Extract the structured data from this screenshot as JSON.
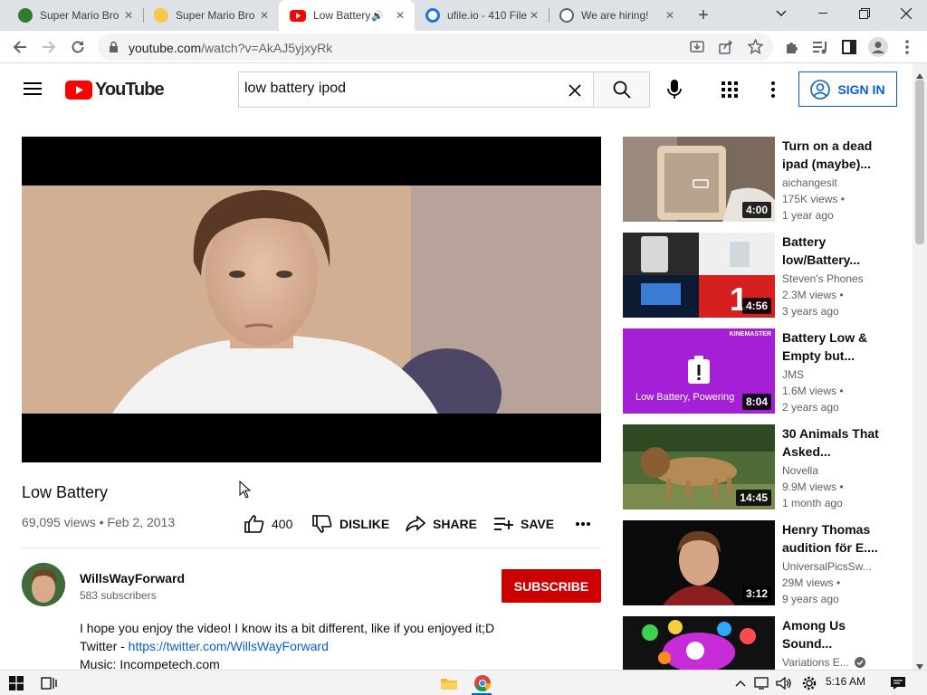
{
  "browser": {
    "tabs": [
      {
        "title": "Super Mario Bro",
        "favicon": "mario-favicon",
        "color": "#2e7d32",
        "active": false
      },
      {
        "title": "Super Mario Bro",
        "favicon": "banana-favicon",
        "color": "#f9c74f",
        "active": false
      },
      {
        "title": "Low Battery",
        "favicon": "youtube-favicon",
        "color": "#ff0000",
        "active": true
      },
      {
        "title": "ufile.io - 410 File",
        "favicon": "ufile-favicon",
        "color": "#1a73e8",
        "active": false
      },
      {
        "title": "We are hiring!",
        "favicon": "globe-favicon",
        "color": "#5f6368",
        "active": false
      }
    ],
    "new_tab": "+",
    "url_host": "youtube.com",
    "url_path": "/watch?v=AkAJ5yjxyRk"
  },
  "youtube": {
    "logo_text": "YouTube",
    "search_value": "low battery ipod",
    "search_placeholder": "Search",
    "sign_in": "SIGN IN"
  },
  "video": {
    "title": "Low Battery",
    "views": "69,095 views",
    "date": "Feb 2, 2013",
    "likes": "400",
    "dislike_label": "DISLIKE",
    "share_label": "SHARE",
    "save_label": "SAVE"
  },
  "channel": {
    "name": "WillsWayForward",
    "subscribers": "583 subscribers",
    "subscribe_label": "SUBSCRIBE"
  },
  "description": {
    "line1": "I hope you enjoy the video! I know its a bit different, like if you enjoyed it;D",
    "twitter_prefix": "Twitter - ",
    "twitter_link": "https://twitter.com/WillsWayForward",
    "line3": "Music: Incompetech.com"
  },
  "recommendations": [
    {
      "title": "Turn on a dead ipad (maybe)...",
      "channel": "aichangesit",
      "views": "175K views •",
      "age": "1 year ago",
      "duration": "4:00"
    },
    {
      "title": "Battery low/Battery...",
      "channel": "Steven's Phones",
      "views": "2.3M views •",
      "age": "3 years ago",
      "duration": "4:56"
    },
    {
      "title": "Battery Low & Empty but...",
      "channel": "JMS",
      "views": "1.6M views •",
      "age": "2 years ago",
      "duration": "8:04",
      "thumb_text": "Low Battery, Powering",
      "thumb_brand": "KINEMASTER"
    },
    {
      "title": "30 Animals That Asked...",
      "channel": "Novella",
      "views": "9.9M views •",
      "age": "1 month ago",
      "duration": "14:45"
    },
    {
      "title": "Henry Thomas audition för E....",
      "channel": "UniversalPicsSw...",
      "views": "29M views •",
      "age": "9 years ago",
      "duration": "3:12"
    },
    {
      "title": "Among Us Sound...",
      "channel": "Variations E...",
      "views": "",
      "age": "",
      "duration": ""
    }
  ],
  "taskbar": {
    "time": "5:16 AM"
  }
}
